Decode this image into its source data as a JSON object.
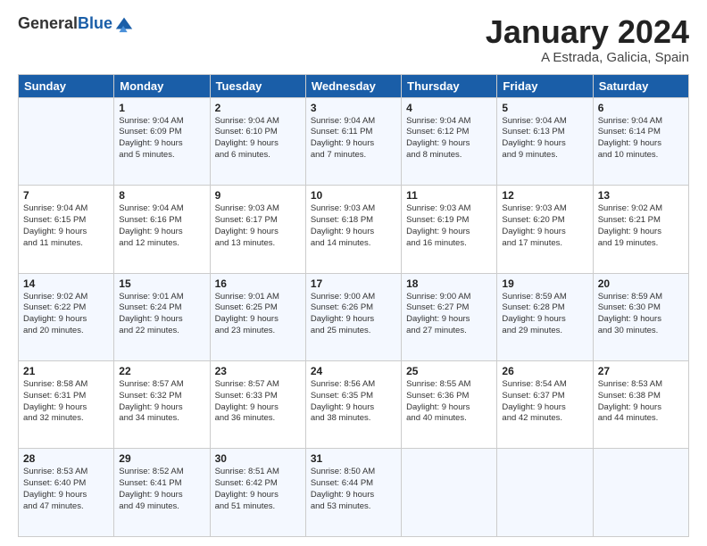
{
  "logo": {
    "general": "General",
    "blue": "Blue"
  },
  "title": "January 2024",
  "location": "A Estrada, Galicia, Spain",
  "days_of_week": [
    "Sunday",
    "Monday",
    "Tuesday",
    "Wednesday",
    "Thursday",
    "Friday",
    "Saturday"
  ],
  "weeks": [
    [
      {
        "day": "",
        "info": ""
      },
      {
        "day": "1",
        "info": "Sunrise: 9:04 AM\nSunset: 6:09 PM\nDaylight: 9 hours\nand 5 minutes."
      },
      {
        "day": "2",
        "info": "Sunrise: 9:04 AM\nSunset: 6:10 PM\nDaylight: 9 hours\nand 6 minutes."
      },
      {
        "day": "3",
        "info": "Sunrise: 9:04 AM\nSunset: 6:11 PM\nDaylight: 9 hours\nand 7 minutes."
      },
      {
        "day": "4",
        "info": "Sunrise: 9:04 AM\nSunset: 6:12 PM\nDaylight: 9 hours\nand 8 minutes."
      },
      {
        "day": "5",
        "info": "Sunrise: 9:04 AM\nSunset: 6:13 PM\nDaylight: 9 hours\nand 9 minutes."
      },
      {
        "day": "6",
        "info": "Sunrise: 9:04 AM\nSunset: 6:14 PM\nDaylight: 9 hours\nand 10 minutes."
      }
    ],
    [
      {
        "day": "7",
        "info": "Sunrise: 9:04 AM\nSunset: 6:15 PM\nDaylight: 9 hours\nand 11 minutes."
      },
      {
        "day": "8",
        "info": "Sunrise: 9:04 AM\nSunset: 6:16 PM\nDaylight: 9 hours\nand 12 minutes."
      },
      {
        "day": "9",
        "info": "Sunrise: 9:03 AM\nSunset: 6:17 PM\nDaylight: 9 hours\nand 13 minutes."
      },
      {
        "day": "10",
        "info": "Sunrise: 9:03 AM\nSunset: 6:18 PM\nDaylight: 9 hours\nand 14 minutes."
      },
      {
        "day": "11",
        "info": "Sunrise: 9:03 AM\nSunset: 6:19 PM\nDaylight: 9 hours\nand 16 minutes."
      },
      {
        "day": "12",
        "info": "Sunrise: 9:03 AM\nSunset: 6:20 PM\nDaylight: 9 hours\nand 17 minutes."
      },
      {
        "day": "13",
        "info": "Sunrise: 9:02 AM\nSunset: 6:21 PM\nDaylight: 9 hours\nand 19 minutes."
      }
    ],
    [
      {
        "day": "14",
        "info": "Sunrise: 9:02 AM\nSunset: 6:22 PM\nDaylight: 9 hours\nand 20 minutes."
      },
      {
        "day": "15",
        "info": "Sunrise: 9:01 AM\nSunset: 6:24 PM\nDaylight: 9 hours\nand 22 minutes."
      },
      {
        "day": "16",
        "info": "Sunrise: 9:01 AM\nSunset: 6:25 PM\nDaylight: 9 hours\nand 23 minutes."
      },
      {
        "day": "17",
        "info": "Sunrise: 9:00 AM\nSunset: 6:26 PM\nDaylight: 9 hours\nand 25 minutes."
      },
      {
        "day": "18",
        "info": "Sunrise: 9:00 AM\nSunset: 6:27 PM\nDaylight: 9 hours\nand 27 minutes."
      },
      {
        "day": "19",
        "info": "Sunrise: 8:59 AM\nSunset: 6:28 PM\nDaylight: 9 hours\nand 29 minutes."
      },
      {
        "day": "20",
        "info": "Sunrise: 8:59 AM\nSunset: 6:30 PM\nDaylight: 9 hours\nand 30 minutes."
      }
    ],
    [
      {
        "day": "21",
        "info": "Sunrise: 8:58 AM\nSunset: 6:31 PM\nDaylight: 9 hours\nand 32 minutes."
      },
      {
        "day": "22",
        "info": "Sunrise: 8:57 AM\nSunset: 6:32 PM\nDaylight: 9 hours\nand 34 minutes."
      },
      {
        "day": "23",
        "info": "Sunrise: 8:57 AM\nSunset: 6:33 PM\nDaylight: 9 hours\nand 36 minutes."
      },
      {
        "day": "24",
        "info": "Sunrise: 8:56 AM\nSunset: 6:35 PM\nDaylight: 9 hours\nand 38 minutes."
      },
      {
        "day": "25",
        "info": "Sunrise: 8:55 AM\nSunset: 6:36 PM\nDaylight: 9 hours\nand 40 minutes."
      },
      {
        "day": "26",
        "info": "Sunrise: 8:54 AM\nSunset: 6:37 PM\nDaylight: 9 hours\nand 42 minutes."
      },
      {
        "day": "27",
        "info": "Sunrise: 8:53 AM\nSunset: 6:38 PM\nDaylight: 9 hours\nand 44 minutes."
      }
    ],
    [
      {
        "day": "28",
        "info": "Sunrise: 8:53 AM\nSunset: 6:40 PM\nDaylight: 9 hours\nand 47 minutes."
      },
      {
        "day": "29",
        "info": "Sunrise: 8:52 AM\nSunset: 6:41 PM\nDaylight: 9 hours\nand 49 minutes."
      },
      {
        "day": "30",
        "info": "Sunrise: 8:51 AM\nSunset: 6:42 PM\nDaylight: 9 hours\nand 51 minutes."
      },
      {
        "day": "31",
        "info": "Sunrise: 8:50 AM\nSunset: 6:44 PM\nDaylight: 9 hours\nand 53 minutes."
      },
      {
        "day": "",
        "info": ""
      },
      {
        "day": "",
        "info": ""
      },
      {
        "day": "",
        "info": ""
      }
    ]
  ]
}
